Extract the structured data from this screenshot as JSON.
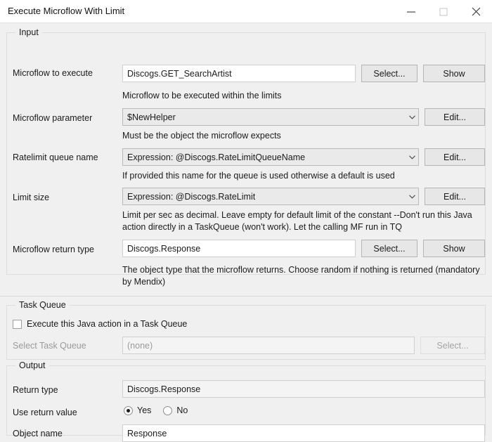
{
  "window": {
    "title": "Execute Microflow With Limit",
    "controls": {
      "minimize": "minimize-icon",
      "maximize": "maximize-icon",
      "close": "close-icon"
    }
  },
  "input_section": {
    "legend": "Input",
    "microflow_to_execute": {
      "label": "Microflow to execute",
      "value": "Discogs.GET_SearchArtist",
      "help": "Microflow to be executed within the limits",
      "select_label": "Select...",
      "show_label": "Show"
    },
    "microflow_parameter": {
      "label": "Microflow parameter",
      "value": "$NewHelper",
      "help": "Must be the object the microflow expects",
      "edit_label": "Edit..."
    },
    "ratelimit_queue_name": {
      "label": "Ratelimit queue name",
      "value": "Expression: @Discogs.RateLimitQueueName",
      "help": "If provided this name for the queue is used otherwise a default is used",
      "edit_label": "Edit..."
    },
    "limit_size": {
      "label": "Limit size",
      "value": "Expression: @Discogs.RateLimit",
      "help": "Limit per sec as decimal. Leave empty for default limit of the constant --Don't run this Java action directly in a TaskQueue (won't work). Let the calling MF run in TQ",
      "edit_label": "Edit..."
    },
    "microflow_return_type": {
      "label": "Microflow return type",
      "value": "Discogs.Response",
      "help": "The object type that the microflow returns. Choose random if nothing is returned (mandatory by Mendix)",
      "select_label": "Select...",
      "show_label": "Show"
    }
  },
  "task_queue_section": {
    "legend": "Task Queue",
    "checkbox_label": "Execute this Java action in a Task Queue",
    "checkbox_checked": false,
    "select_task_queue": {
      "label": "Select Task Queue",
      "placeholder": "(none)",
      "select_label": "Select..."
    }
  },
  "output_section": {
    "legend": "Output",
    "return_type": {
      "label": "Return type",
      "value": "Discogs.Response"
    },
    "use_return_value": {
      "label": "Use return value",
      "yes_label": "Yes",
      "no_label": "No",
      "selected": "Yes"
    },
    "object_name": {
      "label": "Object name",
      "value": "Response"
    }
  },
  "colors": {
    "window_background": "#f0f0f0",
    "titlebar_background": "#ffffff",
    "field_border": "#cfcfcf",
    "combo_background": "#eaeaea",
    "button_background": "#e7e7e7",
    "disabled_text": "#a3a3a3",
    "text": "#1b1b1b"
  }
}
